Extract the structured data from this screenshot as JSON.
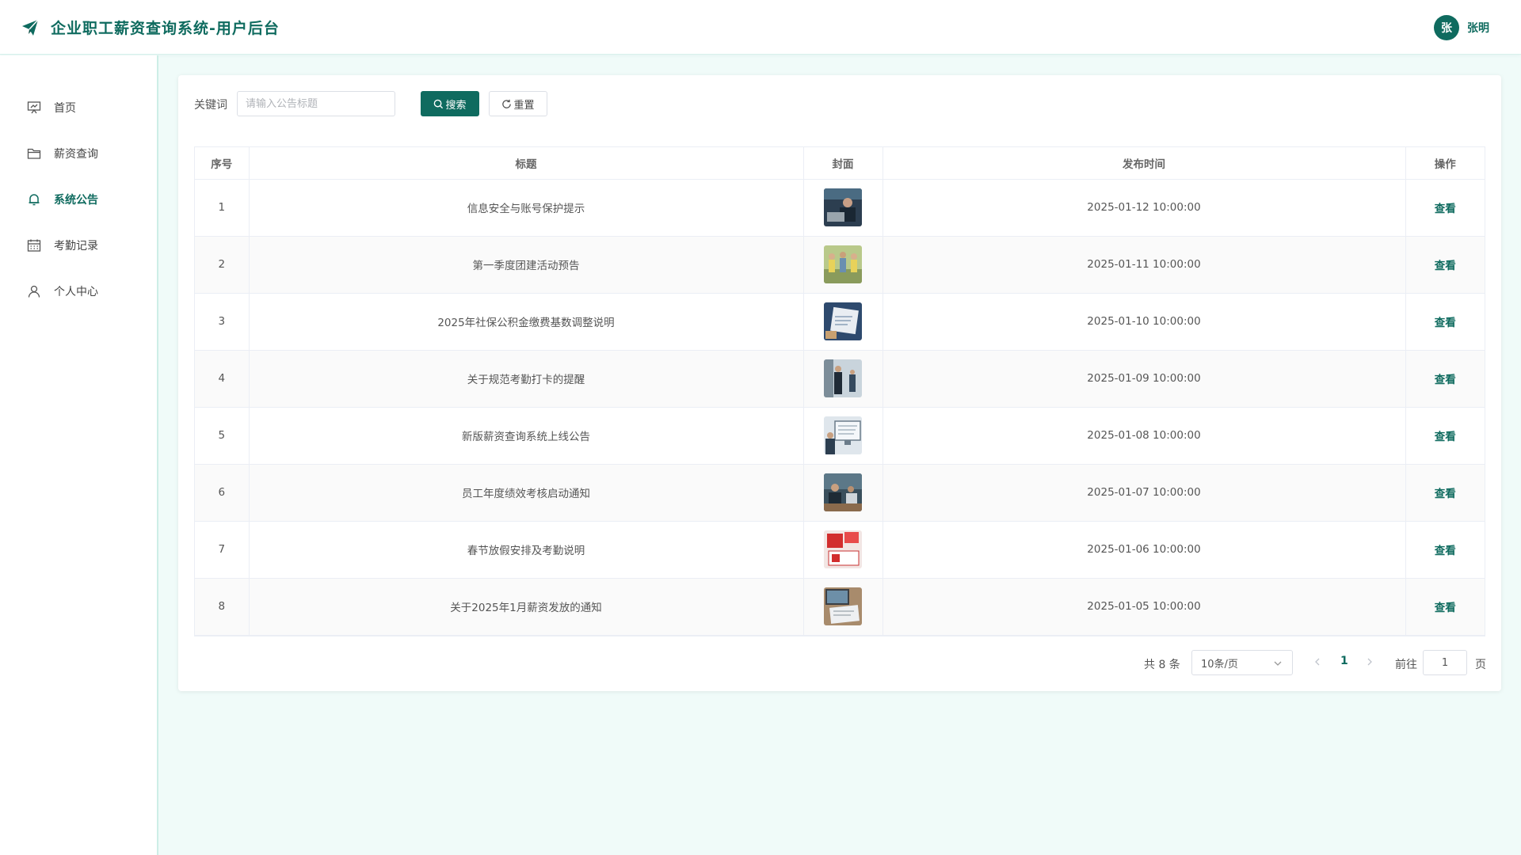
{
  "header": {
    "title": "企业职工薪资查询系统-用户后台",
    "avatar_initial": "张",
    "username": "张明",
    "brand_color": "#0f6b5f",
    "logo_icon": "paper-plane-icon"
  },
  "sidebar": {
    "items": [
      {
        "label": "首页",
        "icon": "presentation-icon",
        "active": false
      },
      {
        "label": "薪资查询",
        "icon": "folder-icon",
        "active": false
      },
      {
        "label": "系统公告",
        "icon": "bell-icon",
        "active": true
      },
      {
        "label": "考勤记录",
        "icon": "calendar-icon",
        "active": false
      },
      {
        "label": "个人中心",
        "icon": "user-icon",
        "active": false
      }
    ]
  },
  "search": {
    "keyword_label": "关键词",
    "placeholder": "请输入公告标题",
    "value": "",
    "search_label": "搜索",
    "reset_label": "重置"
  },
  "table": {
    "columns": [
      "序号",
      "标题",
      "封面",
      "发布时间",
      "操作"
    ],
    "rows": [
      {
        "index": "1",
        "title": "信息安全与账号保护提示",
        "time": "2025-01-12 10:00:00",
        "action": "查看"
      },
      {
        "index": "2",
        "title": "第一季度团建活动预告",
        "time": "2025-01-11 10:00:00",
        "action": "查看"
      },
      {
        "index": "3",
        "title": "2025年社保公积金缴费基数调整说明",
        "time": "2025-01-10 10:00:00",
        "action": "查看"
      },
      {
        "index": "4",
        "title": "关于规范考勤打卡的提醒",
        "time": "2025-01-09 10:00:00",
        "action": "查看"
      },
      {
        "index": "5",
        "title": "新版薪资查询系统上线公告",
        "time": "2025-01-08 10:00:00",
        "action": "查看"
      },
      {
        "index": "6",
        "title": "员工年度绩效考核启动通知",
        "time": "2025-01-07 10:00:00",
        "action": "查看"
      },
      {
        "index": "7",
        "title": "春节放假安排及考勤说明",
        "time": "2025-01-06 10:00:00",
        "action": "查看"
      },
      {
        "index": "8",
        "title": "关于2025年1月薪资发放的通知",
        "time": "2025-01-05 10:00:00",
        "action": "查看"
      }
    ]
  },
  "pagination": {
    "total_text": "共 8 条",
    "page_size": "10条/页",
    "current_page": "1",
    "goto_label": "前往",
    "goto_value": "1",
    "page_unit": "页"
  }
}
